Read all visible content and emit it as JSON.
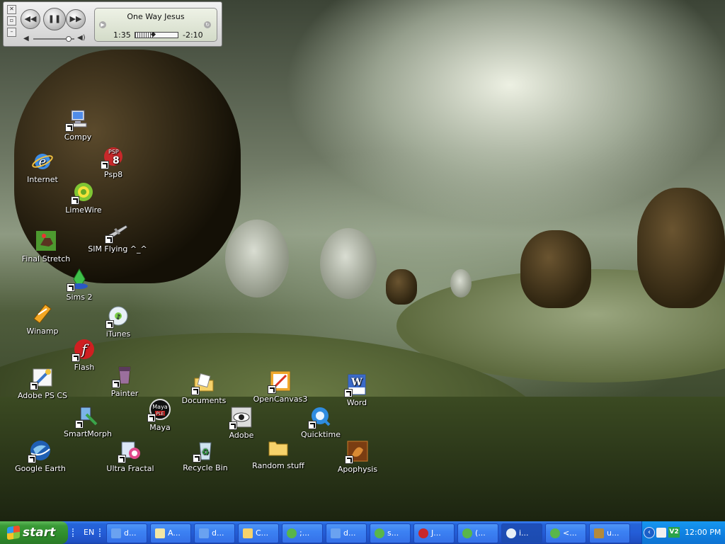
{
  "media_player": {
    "track_title": "One Way Jesus",
    "time_elapsed": "1:35",
    "time_remaining": "-2:10",
    "progress": 0.42,
    "volume": 0.85
  },
  "desktop_icons": [
    {
      "label": "Compy",
      "icon": "computer-icon"
    },
    {
      "label": "Internet",
      "icon": "internet-explorer-icon"
    },
    {
      "label": "Psp8",
      "icon": "psp8-icon"
    },
    {
      "label": "LimeWire",
      "icon": "limewire-icon"
    },
    {
      "label": "Final Stretch",
      "icon": "final-stretch-icon"
    },
    {
      "label": "SIM Flying ^_^",
      "icon": "plane-icon"
    },
    {
      "label": "Sims 2",
      "icon": "sims2-icon"
    },
    {
      "label": "Winamp",
      "icon": "winamp-icon"
    },
    {
      "label": "iTunes",
      "icon": "itunes-icon"
    },
    {
      "label": "Flash",
      "icon": "flash-icon"
    },
    {
      "label": "Adobe PS CS",
      "icon": "photoshop-icon"
    },
    {
      "label": "Painter",
      "icon": "painter-icon"
    },
    {
      "label": "SmartMorph",
      "icon": "smartmorph-icon"
    },
    {
      "label": "Maya",
      "icon": "maya-icon"
    },
    {
      "label": "Documents",
      "icon": "documents-icon"
    },
    {
      "label": "OpenCanvas3",
      "icon": "opencanvas-icon"
    },
    {
      "label": "Word",
      "icon": "word-icon"
    },
    {
      "label": "Google Earth",
      "icon": "google-earth-icon"
    },
    {
      "label": "Ultra Fractal",
      "icon": "ultra-fractal-icon"
    },
    {
      "label": "Recycle Bin",
      "icon": "recycle-bin-icon"
    },
    {
      "label": "Adobe",
      "icon": "adobe-icon"
    },
    {
      "label": "Random stuff",
      "icon": "folder-icon"
    },
    {
      "label": "Quicktime",
      "icon": "quicktime-icon"
    },
    {
      "label": "Apophysis",
      "icon": "apophysis-icon"
    }
  ],
  "taskbar": {
    "start_label": "start",
    "language": "EN",
    "buttons": [
      {
        "label": "d...",
        "icon": "ie-page-icon"
      },
      {
        "label": "A...",
        "icon": "notepad-icon"
      },
      {
        "label": "d...",
        "icon": "ie-page-icon"
      },
      {
        "label": "C...",
        "icon": "folder-icon"
      },
      {
        "label": ";...",
        "icon": "msn-icon"
      },
      {
        "label": "d...",
        "icon": "ie-page-icon"
      },
      {
        "label": "s...",
        "icon": "msn-icon"
      },
      {
        "label": "J...",
        "icon": "psp8-icon"
      },
      {
        "label": "(...",
        "icon": "msn-icon"
      },
      {
        "label": "i...",
        "icon": "itunes-icon"
      },
      {
        "label": "<...",
        "icon": "msn-icon"
      },
      {
        "label": "u...",
        "icon": "app-icon"
      }
    ],
    "active_index": 9,
    "clock": "12:00 PM"
  }
}
